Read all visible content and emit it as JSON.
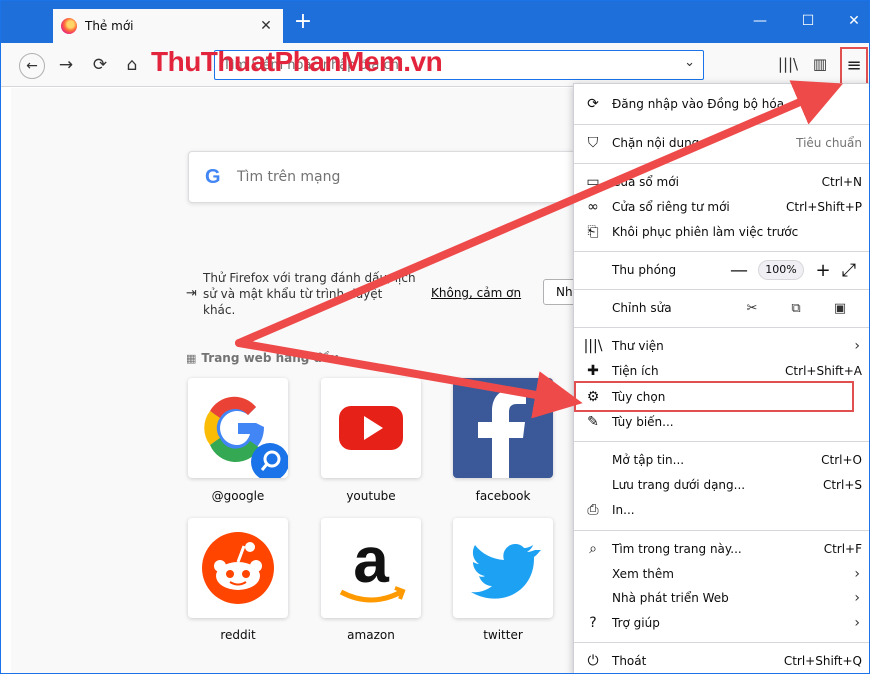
{
  "tab": {
    "title": "Thẻ mới",
    "close": "✕",
    "new": "+"
  },
  "window": {
    "minimize": "—",
    "maximize": "☐",
    "close": "✕"
  },
  "nav": {
    "back": "←",
    "forward": "→",
    "reload": "⟳",
    "home": "⌂"
  },
  "urlbar": {
    "placeholder": "Tìm kiếm hoặc nhập địa chỉ",
    "drop": "⌄"
  },
  "watermark": {
    "part1": "ThuThuat",
    "part2": "PhanMem",
    "part3": ".vn"
  },
  "toolbar": {
    "library": "|||\\",
    "sidebar": "▥",
    "menu": "≡"
  },
  "search": {
    "g": "G",
    "placeholder": "Tìm trên mạng"
  },
  "import": {
    "text": "Thử Firefox với trang đánh dấu, lịch sử và mật khẩu từ trình duyệt khác.",
    "no": "Không, cảm ơn",
    "btn": "Nhập"
  },
  "topsites": {
    "header": "Trang web hàng đầu ⌄",
    "grid_icon": "▦"
  },
  "tiles": [
    {
      "label": "@google"
    },
    {
      "label": "youtube"
    },
    {
      "label": "facebook"
    },
    {
      "label": "reddit"
    },
    {
      "label": "amazon"
    },
    {
      "label": "twitter"
    }
  ],
  "menu": {
    "sync": "Đăng nhập vào Đồng bộ hóa",
    "blocking": "Chặn nội dung",
    "blocking_value": "Tiêu chuẩn",
    "new_window": "Cửa sổ mới",
    "new_window_sc": "Ctrl+N",
    "private": "Cửa sổ riêng tư mới",
    "private_sc": "Ctrl+Shift+P",
    "restore": "Khôi phục phiên làm việc trước",
    "zoom": "Thu phóng",
    "zoom_value": "100%",
    "zoom_minus": "—",
    "zoom_plus": "+",
    "zoom_full": "⤢",
    "edit": "Chỉnh sửa",
    "library": "Thư viện",
    "addons": "Tiện ích",
    "addons_sc": "Ctrl+Shift+A",
    "options": "Tùy chọn",
    "customize": "Tùy biến...",
    "open_file": "Mở tập tin...",
    "open_file_sc": "Ctrl+O",
    "save_page": "Lưu trang dưới dạng...",
    "save_page_sc": "Ctrl+S",
    "print": "In...",
    "find": "Tìm trong trang này...",
    "find_sc": "Ctrl+F",
    "more": "Xem thêm",
    "webdev": "Nhà phát triển Web",
    "help": "Trợ giúp",
    "quit": "Thoát",
    "quit_sc": "Ctrl+Shift+Q",
    "chevron": "›"
  },
  "colors": {
    "accent": "#1e6fd9",
    "highlight": "#e05050",
    "arrow": "#ef4a4a"
  }
}
